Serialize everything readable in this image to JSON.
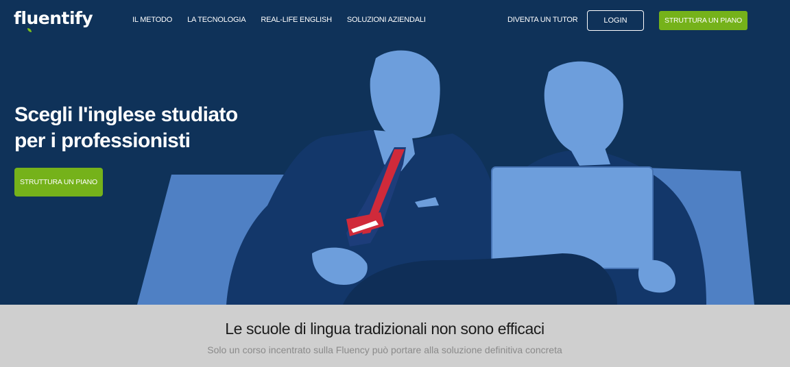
{
  "brand": {
    "name": "fluentify"
  },
  "nav": {
    "links": [
      {
        "label": "IL METODO"
      },
      {
        "label": "LA TECNOLOGIA"
      },
      {
        "label": "REAL-LIFE ENGLISH"
      },
      {
        "label": "SOLUZIONI AZIENDALI"
      }
    ],
    "tutor_label": "DIVENTA UN TUTOR",
    "login_label": "LOGIN",
    "plan_label": "STRUTTURA UN PIANO"
  },
  "hero": {
    "title_line1": "Scegli l'inglese studiato",
    "title_line2": "per i professionisti",
    "cta_label": "STRUTTURA UN PIANO"
  },
  "section": {
    "title": "Le scuole di lingua tradizionali non sono efficaci",
    "subtitle": "Solo un corso incentrato sulla Fluency può portare alla soluzione definitiva concreta"
  },
  "colors": {
    "hero_bg": "#0f3259",
    "accent_green": "#75b21a",
    "figure_blue": "#5b8fd0",
    "band_bg": "#cfcfcf"
  }
}
